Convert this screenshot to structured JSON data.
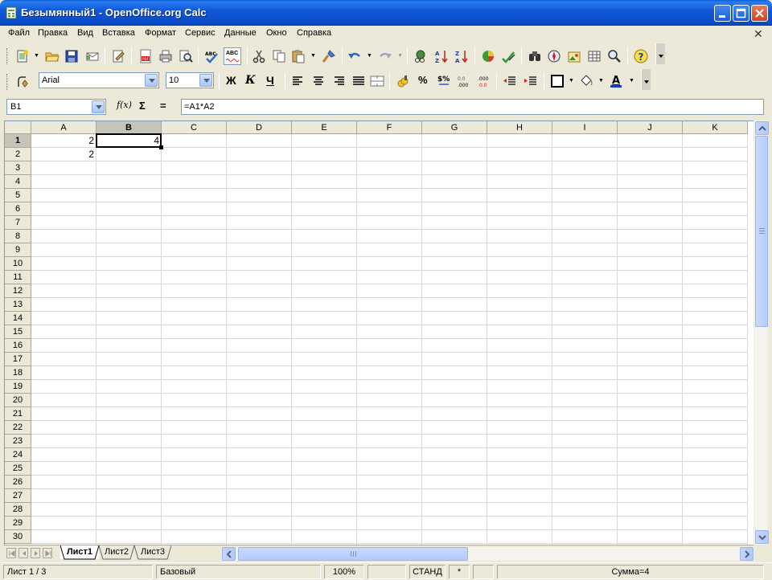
{
  "window": {
    "title": "Безымянный1 - OpenOffice.org Calc",
    "title_color": "#ffffff",
    "titlebar_color": "#0a4cc8"
  },
  "menu": {
    "items": [
      "Файл",
      "Правка",
      "Вид",
      "Вставка",
      "Формат",
      "Сервис",
      "Данные",
      "Окно",
      "Справка"
    ]
  },
  "toolbar_standard": {
    "icons": [
      "new-icon",
      "open-icon",
      "save-icon",
      "email-icon",
      "edit-file-icon",
      "export-pdf-icon",
      "print-icon",
      "page-preview-icon",
      "spellcheck-icon",
      "autospellcheck-icon",
      "cut-icon",
      "copy-icon",
      "paste-icon",
      "format-paintbrush-icon",
      "undo-icon",
      "redo-icon",
      "navigator-icon",
      "sort-ascending-icon",
      "sort-descending-icon",
      "chart-icon",
      "show-draw-icon",
      "find-replace-icon",
      "navigator-compass-icon",
      "gallery-icon",
      "datasources-icon",
      "zoom-icon",
      "help-icon"
    ],
    "spell_label": "ABC"
  },
  "toolbar_formatting": {
    "font_name": "Arial",
    "font_size": "10",
    "bold": "Ж",
    "italic": "К",
    "underline": "Ч"
  },
  "formula_bar": {
    "name_box": "B1",
    "fx_label": "f(x)",
    "sum_label": "Σ",
    "equals_label": "=",
    "formula": "=A1*A2"
  },
  "sheet": {
    "columns": [
      "A",
      "B",
      "C",
      "D",
      "E",
      "F",
      "G",
      "H",
      "I",
      "J",
      "K"
    ],
    "rows": [
      "1",
      "2",
      "3",
      "4",
      "5",
      "6",
      "7",
      "8",
      "9",
      "10",
      "11",
      "12",
      "13",
      "14",
      "15",
      "16",
      "17",
      "18",
      "19",
      "20",
      "21",
      "22",
      "23",
      "24",
      "25",
      "26",
      "27",
      "28",
      "29",
      "30"
    ],
    "selected_column": "B",
    "selected_row": "1",
    "cells": [
      {
        "ref": "A1",
        "value": "2"
      },
      {
        "ref": "A2",
        "value": "2"
      },
      {
        "ref": "B1",
        "value": "4"
      }
    ]
  },
  "tabs": {
    "items": [
      "Лист1",
      "Лист2",
      "Лист3"
    ],
    "active": "Лист1"
  },
  "status": {
    "sheet_pos": "Лист 1 / 3",
    "page_style": "Базовый",
    "zoom": "100%",
    "mode": "СТАНД",
    "modified": "*",
    "sum": "Сумма=4"
  }
}
